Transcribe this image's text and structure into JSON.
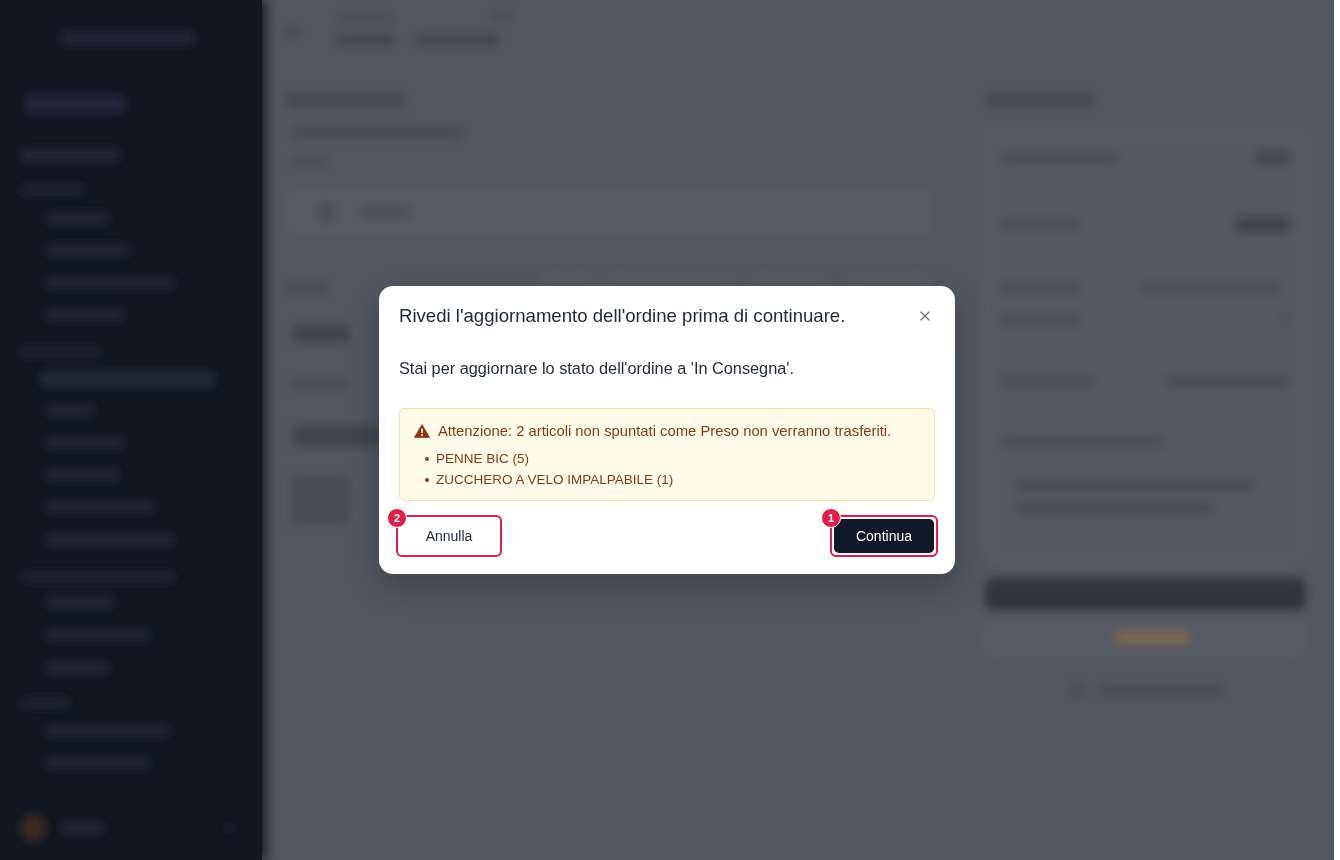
{
  "dialog": {
    "title": "Rivedi l'aggiornamento dell'ordine prima di continuare.",
    "message": "Stai per aggiornare lo stato dell'ordine a 'In Consegna'.",
    "warning": {
      "text": "Attenzione: 2 articoli non spuntati come Preso non verranno trasferiti.",
      "items": [
        "PENNE BIC (5)",
        "ZUCCHERO A VELO IMPALPABILE (1)"
      ]
    },
    "buttons": [
      {
        "label": "Annulla",
        "kind": "secondary",
        "highlighted": true,
        "marker": "2"
      },
      {
        "label": "Continua",
        "kind": "primary",
        "highlighted": true,
        "marker": "1"
      }
    ]
  }
}
